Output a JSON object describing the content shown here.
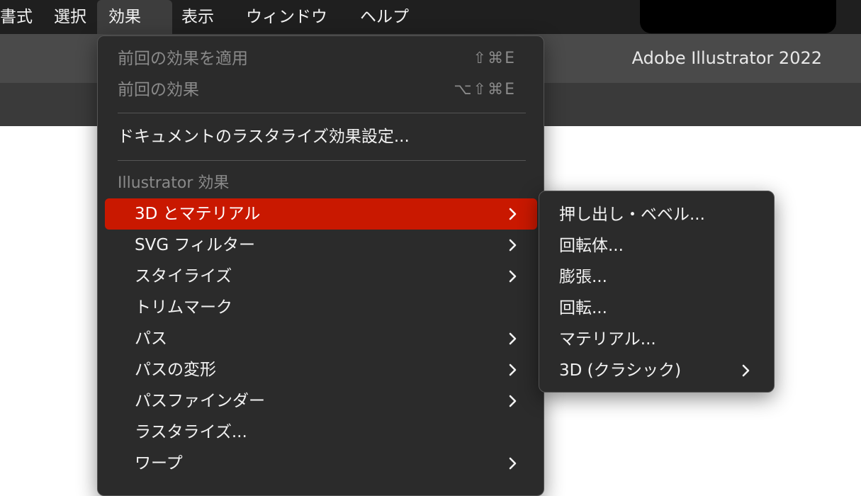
{
  "menubar": {
    "items": [
      "書式",
      "選択",
      "効果",
      "表示",
      "ウィンドウ",
      "ヘルプ"
    ],
    "active": "効果"
  },
  "app": {
    "title": "Adobe Illustrator 2022"
  },
  "menu": {
    "apply_last": {
      "label": "前回の効果を適用",
      "shortcut": "⇧⌘E"
    },
    "last": {
      "label": "前回の効果",
      "shortcut": "⌥⇧⌘E"
    },
    "raster_settings": "ドキュメントのラスタライズ効果設定...",
    "section_illustrator": "Illustrator 効果",
    "items": [
      {
        "label": "3D とマテリアル"
      },
      {
        "label": "SVG フィルター"
      },
      {
        "label": "スタイライズ"
      },
      {
        "label": "トリムマーク"
      },
      {
        "label": "パス"
      },
      {
        "label": "パスの変形"
      },
      {
        "label": "パスファインダー"
      },
      {
        "label": "ラスタライズ..."
      },
      {
        "label": "ワープ"
      }
    ]
  },
  "submenu": {
    "items": [
      {
        "label": "押し出し・ベベル..."
      },
      {
        "label": "回転体..."
      },
      {
        "label": "膨張..."
      },
      {
        "label": "回転..."
      },
      {
        "label": "マテリアル..."
      },
      {
        "label": "3D (クラシック)"
      }
    ]
  },
  "colors": {
    "highlight": "#c91800",
    "menu_bg": "#2b2b2b",
    "menubar_bg": "#1f1f1f"
  }
}
